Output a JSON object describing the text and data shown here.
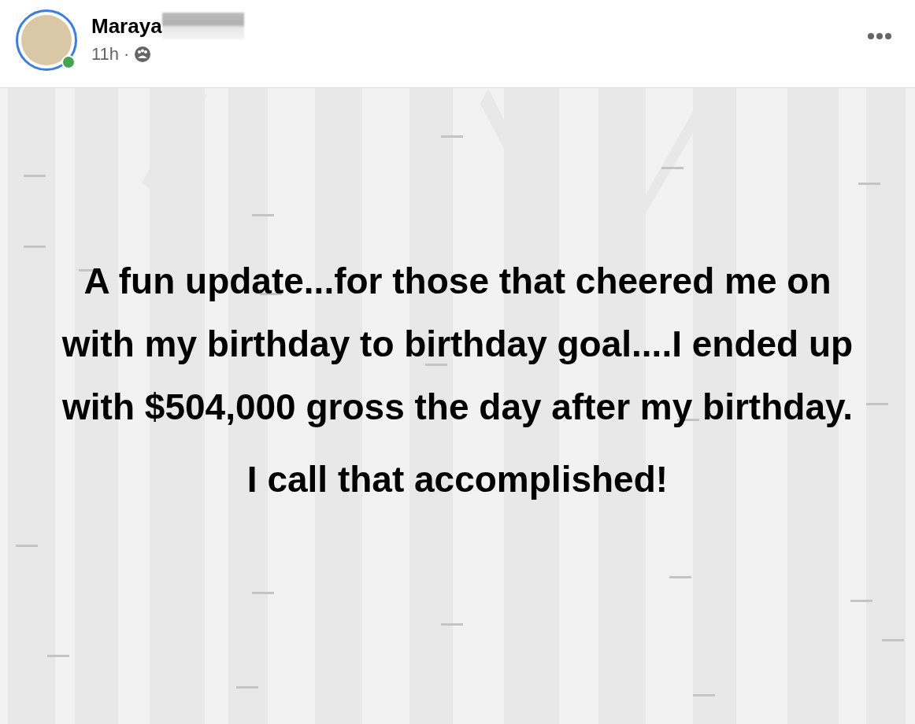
{
  "post": {
    "author": {
      "name": "Maraya",
      "online": true
    },
    "time": "11h",
    "separator": "·",
    "paragraphs": [
      "A fun update...for those that cheered me on with my birthday to birthday goal....I ended up with $504,000 gross the day after my birthday.",
      "I call that accomplished!"
    ]
  }
}
